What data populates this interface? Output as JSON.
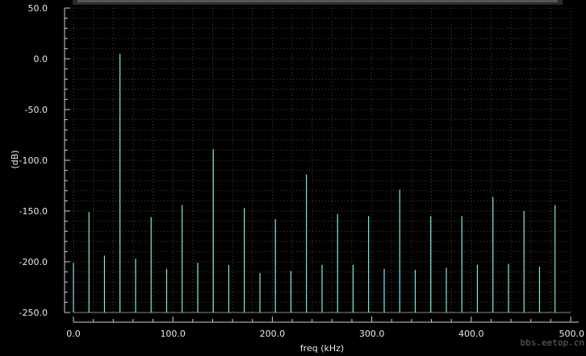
{
  "chart_data": {
    "type": "bar",
    "title": "",
    "xlabel": "freq (kHz)",
    "ylabel": "(dB)",
    "xlim": [
      0,
      500
    ],
    "ylim": [
      -250,
      50
    ],
    "x_ticks": [
      "0.0",
      "100.0",
      "200.0",
      "300.0",
      "400.0",
      "500.0"
    ],
    "y_ticks": [
      "50.0",
      "0.0",
      "-50.0",
      "-100.0",
      "-150.0",
      "-200.0",
      "-250.0"
    ],
    "grid": true,
    "colors": {
      "background": "#000000",
      "stem": "#7fe8e8",
      "grid": "#444444",
      "axis": "#d0d0d0"
    },
    "series": [
      {
        "x": [
          0,
          15.6,
          31.2,
          46.8,
          62.5,
          78.1,
          93.7,
          109.3,
          125,
          140.6,
          156.2,
          171.8,
          187.5,
          203.1,
          218.7,
          234.3,
          250,
          265.6,
          281.2,
          296.8,
          312.5,
          328.1,
          343.7,
          359.3,
          375,
          390.6,
          406.2,
          421.8,
          437.5,
          453.1,
          468.7,
          484.3
        ],
        "values": [
          -201,
          -151,
          -194,
          5,
          -197,
          -156,
          -207,
          -144,
          -201,
          -89,
          -203,
          -147,
          -211,
          -158,
          -209,
          -114,
          -203,
          -153,
          -203,
          -155,
          -207,
          -129,
          -208,
          -155,
          -206,
          -155,
          -203,
          -136,
          -202,
          -150,
          -205,
          -144
        ]
      }
    ]
  },
  "watermark": "bbs.eetop.cn"
}
